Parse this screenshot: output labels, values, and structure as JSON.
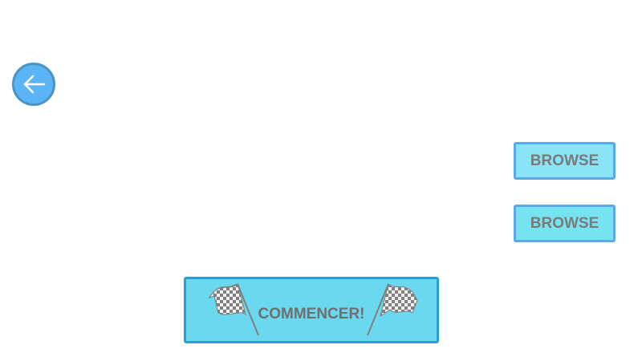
{
  "navigation": {
    "back_icon": "arrow-left-icon"
  },
  "browse_buttons": [
    {
      "label": "BROWSE"
    },
    {
      "label": "BROWSE"
    }
  ],
  "start_button": {
    "label": "COMMENCER!",
    "icon_left": "checkered-flag-icon",
    "icon_right": "checkered-flag-icon"
  },
  "colors": {
    "back_fill": "#5ab4f5",
    "browse_fill": "#88e4f6",
    "start_fill": "#6ad8ef",
    "start_border": "#2a9fd4",
    "text": "#7a7a7a"
  }
}
